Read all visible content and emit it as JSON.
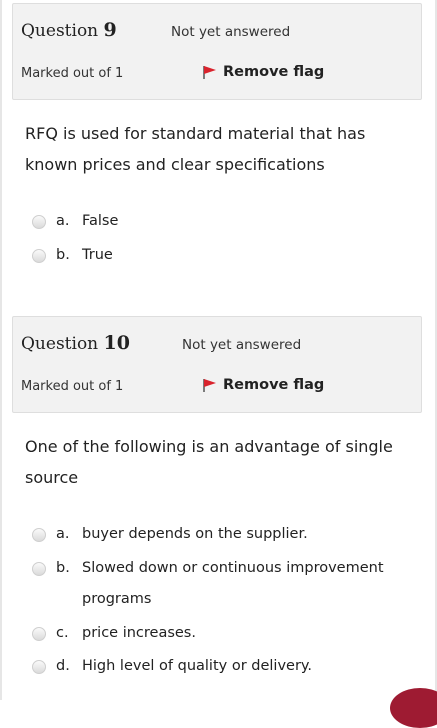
{
  "questions": [
    {
      "title_word": "Question",
      "number": "9",
      "state": "Not yet answered",
      "grade": "Marked out of 1",
      "flag_label": "Remove flag",
      "text": "RFQ is used for standard material that has known prices and clear specifications",
      "options": [
        {
          "letter": "a.",
          "text": "False"
        },
        {
          "letter": "b.",
          "text": "True"
        }
      ]
    },
    {
      "title_word": "Question",
      "number": "10",
      "state": "Not yet answered",
      "grade": "Marked out of 1",
      "flag_label": "Remove flag",
      "text": "One of the following is an advantage of single source",
      "options": [
        {
          "letter": "a.",
          "text": "buyer depends on the supplier."
        },
        {
          "letter": "b.",
          "text": "Slowed down or continuous improvement programs"
        },
        {
          "letter": "c.",
          "text": "price increases."
        },
        {
          "letter": "d.",
          "text": "High level of quality or delivery."
        }
      ]
    }
  ],
  "colors": {
    "flag": "#d9232d",
    "info_bg": "#f2f2f2",
    "accent": "#9e1b32"
  },
  "icons": {
    "flag": "flag-icon",
    "radio": "radio-icon"
  }
}
